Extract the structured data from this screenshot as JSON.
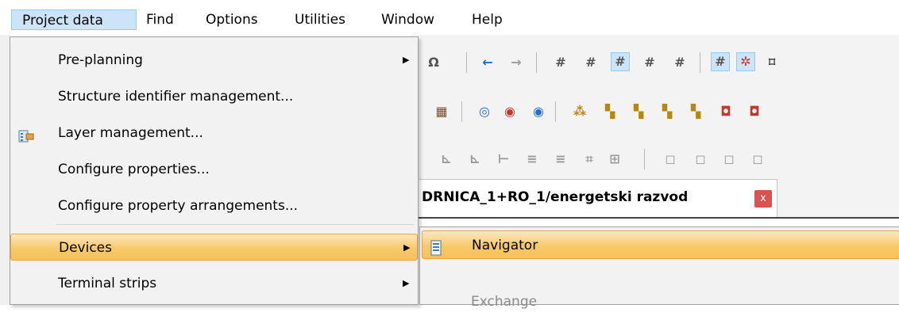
{
  "menubar": {
    "items": [
      {
        "label": "Project data",
        "active": true
      },
      {
        "label": "Find"
      },
      {
        "label": "Options"
      },
      {
        "label": "Utilities"
      },
      {
        "label": "Window"
      },
      {
        "label": "Help"
      }
    ]
  },
  "dropdown": {
    "items": [
      {
        "label": "Pre-planning",
        "submenu": true
      },
      {
        "label": "Structure identifier management..."
      },
      {
        "label": "Layer management...",
        "icon": "layer-management-icon"
      },
      {
        "label": "Configure properties..."
      },
      {
        "label": "Configure property arrangements..."
      },
      {
        "label": "Devices",
        "submenu": true,
        "highlighted": true
      },
      {
        "label": "Terminal strips",
        "submenu": true
      }
    ]
  },
  "submenu": {
    "items": [
      {
        "label": "Navigator",
        "icon": "navigator-icon",
        "highlighted": true
      },
      {
        "label": "Exchange",
        "disabled": true
      }
    ]
  },
  "document_tab": {
    "title": "DRNICA_1+RO_1/energetski razvod",
    "close_label": "x"
  },
  "colors": {
    "highlight_fill": "#f8c96a",
    "highlight_border": "#e8a43a",
    "menubar_active": "#cce4f7",
    "close_button": "#d9534f"
  }
}
